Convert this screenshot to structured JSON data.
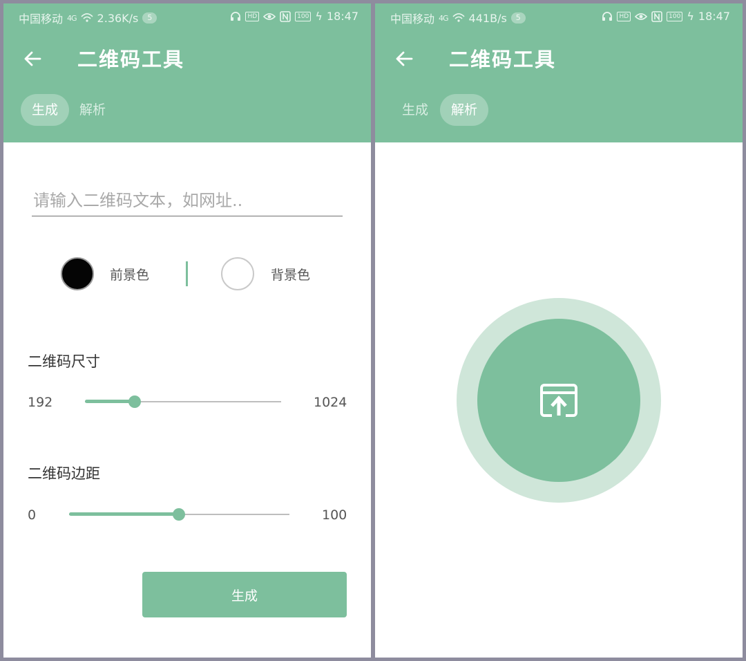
{
  "left": {
    "status_bar": {
      "carrier": "中国移动",
      "signal": "4G",
      "speed": "2.36K/s",
      "notif_count": "5",
      "icons": [
        "headset-icon",
        "hd-icon",
        "eye-icon",
        "nfc-icon",
        "battery-icon",
        "charging-icon"
      ],
      "battery": "100",
      "time": "18:47"
    },
    "header": {
      "title": "二维码工具"
    },
    "tabs": [
      {
        "label": "生成",
        "active": true
      },
      {
        "label": "解析",
        "active": false
      }
    ],
    "form": {
      "text_placeholder": "请输入二维码文本，如网址..",
      "text_value": "",
      "foreground_label": "前景色",
      "foreground_color": "#050505",
      "background_label": "背景色",
      "background_color": "#ffffff",
      "size": {
        "label": "二维码尺寸",
        "min": "192",
        "max": "1024",
        "value": 384
      },
      "margin": {
        "label": "二维码边距",
        "min": "0",
        "max": "100",
        "value": 50
      },
      "generate_label": "生成"
    }
  },
  "right": {
    "status_bar": {
      "carrier": "中国移动",
      "signal": "4G",
      "speed": "441B/s",
      "notif_count": "5",
      "icons": [
        "headset-icon",
        "hd-icon",
        "eye-icon",
        "nfc-icon",
        "battery-icon",
        "charging-icon"
      ],
      "battery": "100",
      "time": "18:47"
    },
    "header": {
      "title": "二维码工具"
    },
    "tabs": [
      {
        "label": "生成",
        "active": false
      },
      {
        "label": "解析",
        "active": true
      }
    ],
    "upload": {
      "icon": "upload-image-icon"
    }
  },
  "colors": {
    "accent": "#7dbf9d",
    "accent_light": "#cfe6d9",
    "frame": "#8e8c9e"
  }
}
